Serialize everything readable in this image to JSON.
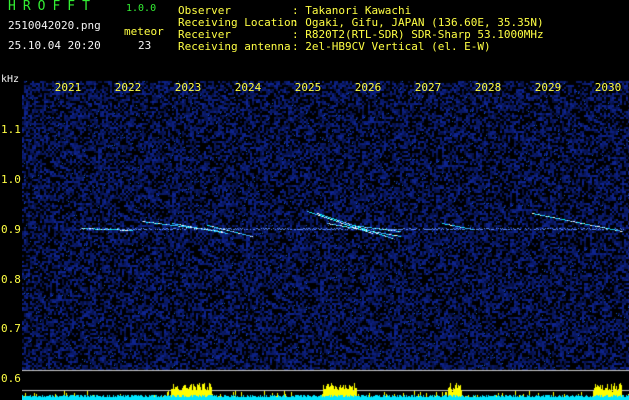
{
  "header": {
    "app_title": "HROFFT",
    "app_version": "1.0.0",
    "file_name": "2510042020.png",
    "meteor_label": "meteor",
    "datetime": "25.10.04 20:20",
    "meteor_count": "23",
    "info_labels": "Observer\nReceiving Location\nReceiver\nReceiving antenna",
    "info_values": ": Takanori Kawachi\n: Ogaki, Gifu, JAPAN (136.60E, 35.35N)\n: R820T2(RTL-SDR) SDR-Sharp 53.1000MHz\n: 2el-HB9CV Vertical (el. E-W)"
  },
  "axis": {
    "unit": "kHz",
    "y_ticks": [
      "1.1",
      "1.0",
      "0.9",
      "0.8",
      "0.7",
      "0.6"
    ],
    "x_ticks": [
      "2021",
      "2022",
      "2023",
      "2024",
      "2025",
      "2026",
      "2027",
      "2028",
      "2029",
      "2030"
    ]
  },
  "colors": {
    "background": "#000000",
    "noise": "#0a1a6e",
    "echo": "#00ffff",
    "trace_line": "#5a8cff",
    "cyan_band": "#00e6ff",
    "yellow_band": "#ffff00",
    "ref_line": "#c8c8c8"
  }
}
